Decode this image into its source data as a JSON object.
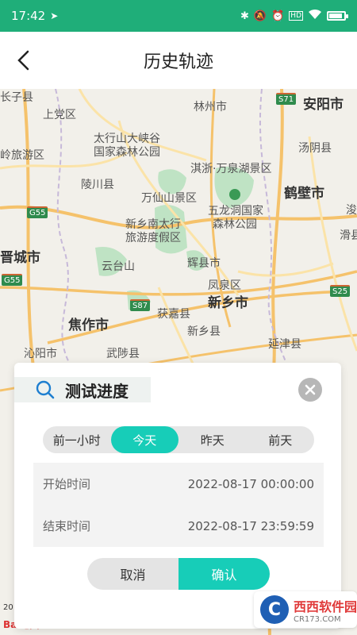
{
  "status_bar": {
    "time": "17:42",
    "hd": "HD"
  },
  "header": {
    "title": "历史轨迹"
  },
  "map": {
    "labels": [
      {
        "text": "长子县",
        "big": false
      },
      {
        "text": "上党区",
        "big": false
      },
      {
        "text": "林州市",
        "big": false
      },
      {
        "text": "安阳市",
        "big": true
      },
      {
        "text": "太行山大峡谷",
        "big": false
      },
      {
        "text": "国家森林公园",
        "big": false
      },
      {
        "text": "岭旅游区",
        "big": false
      },
      {
        "text": "汤阴县",
        "big": false
      },
      {
        "text": "淇浙·万泉湖景区",
        "big": false
      },
      {
        "text": "陵川县",
        "big": false
      },
      {
        "text": "万仙山景区",
        "big": false
      },
      {
        "text": "鹤壁市",
        "big": true
      },
      {
        "text": "五龙洞国家",
        "big": false
      },
      {
        "text": "森林公园",
        "big": false
      },
      {
        "text": "新乡南太行",
        "big": false
      },
      {
        "text": "旅游度假区",
        "big": false
      },
      {
        "text": "晋城市",
        "big": true
      },
      {
        "text": "云台山",
        "big": false
      },
      {
        "text": "辉县市",
        "big": false
      },
      {
        "text": "凤泉区",
        "big": false
      },
      {
        "text": "新乡市",
        "big": true
      },
      {
        "text": "获嘉县",
        "big": false
      },
      {
        "text": "焦作市",
        "big": true
      },
      {
        "text": "新乡县",
        "big": false
      },
      {
        "text": "延津县",
        "big": false
      },
      {
        "text": "武陟县",
        "big": false
      },
      {
        "text": "沁阳市",
        "big": false
      },
      {
        "text": "滑县",
        "big": false
      },
      {
        "text": "浚",
        "big": false
      }
    ],
    "highways": [
      "S71",
      "G55",
      "G55",
      "S87",
      "S25"
    ],
    "scale": "20",
    "baidu": "Bai地图"
  },
  "panel": {
    "device_name": "测试进度",
    "segments": [
      {
        "label": "前一小时",
        "active": false
      },
      {
        "label": "今天",
        "active": true
      },
      {
        "label": "昨天",
        "active": false
      },
      {
        "label": "前天",
        "active": false
      }
    ],
    "start_label": "开始时间",
    "start_value": "2022-08-17 00:00:00",
    "end_label": "结束时间",
    "end_value": "2022-08-17 23:59:59",
    "cancel_label": "取消",
    "confirm_label": "确认"
  },
  "watermark": {
    "logo": "C",
    "name": "西西软件园",
    "site": "CR173.COM"
  },
  "colors": {
    "status_bar": "#1fae79",
    "accent": "#17cdb8"
  }
}
